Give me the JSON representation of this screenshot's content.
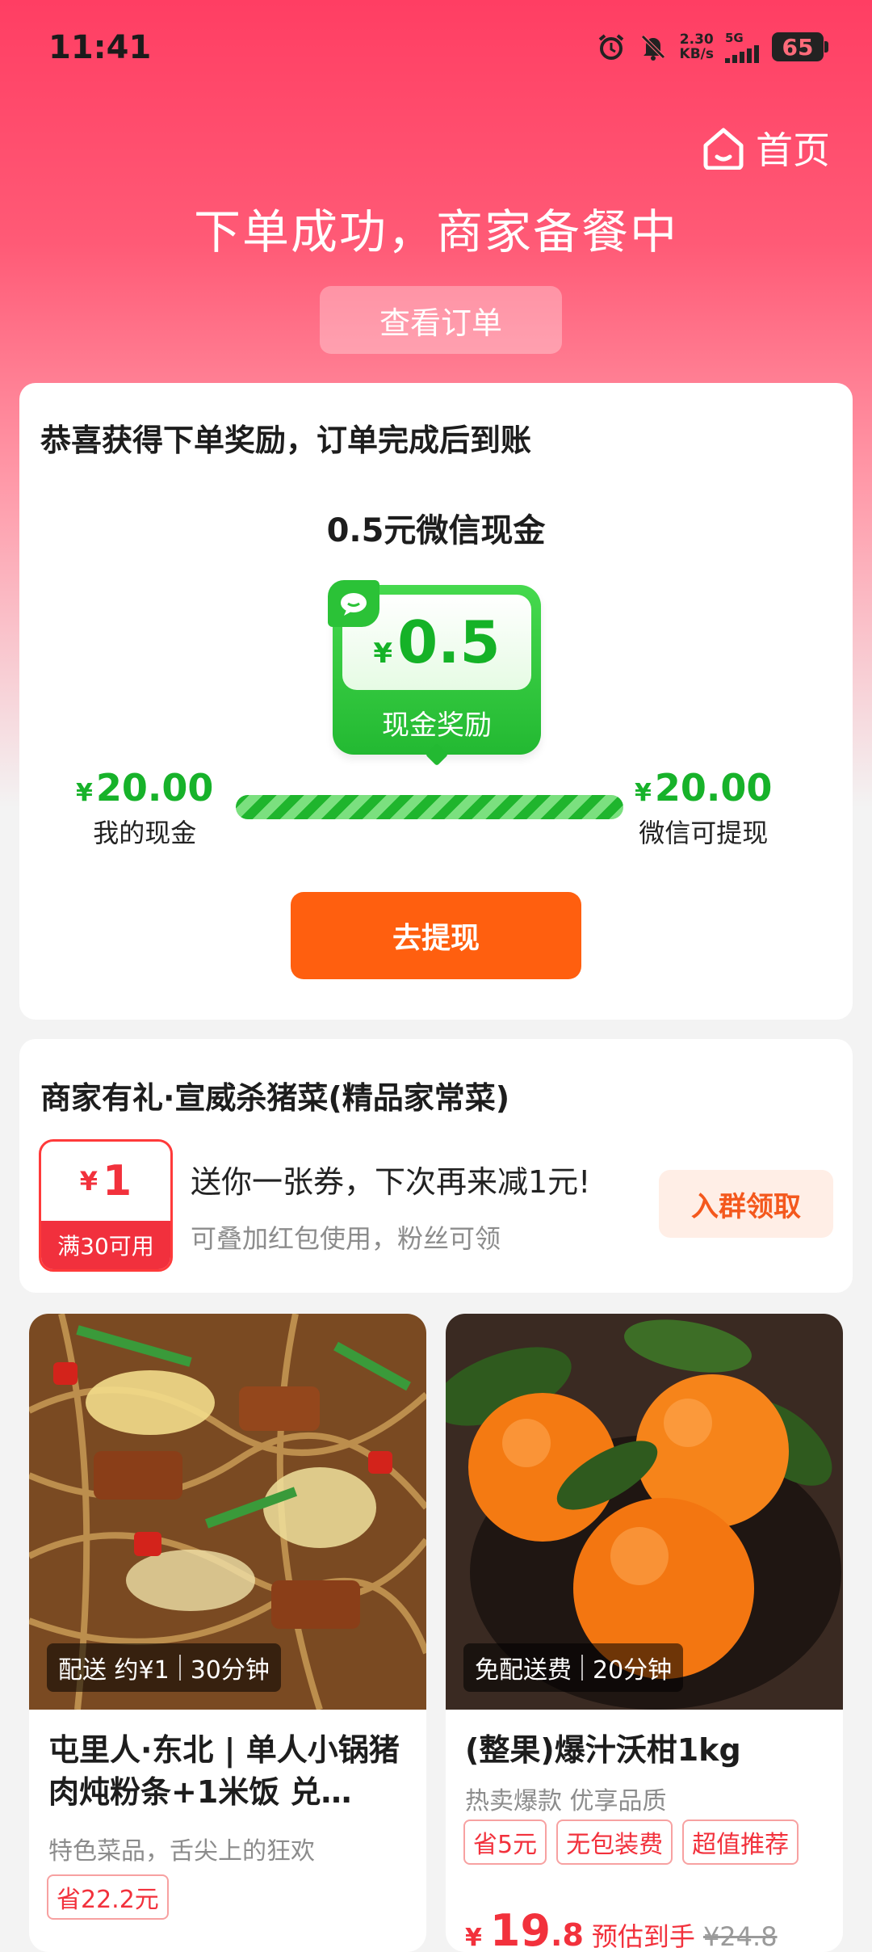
{
  "status_bar": {
    "time": "11:41",
    "net_speed_value": "2.30",
    "net_speed_unit": "KB/s",
    "network": "5G",
    "battery": "65"
  },
  "header": {
    "home_label": "首页",
    "headline": "下单成功，商家备餐中",
    "view_order_label": "查看订单"
  },
  "reward": {
    "title": "恭喜获得下单奖励，订单完成后到账",
    "amount_text": "0.5元微信现金",
    "badge_currency": "¥",
    "badge_value": "0.5",
    "badge_caption": "现金奖励",
    "my_cash_currency": "¥",
    "my_cash_value": "20.00",
    "my_cash_label": "我的现金",
    "withdrawable_currency": "¥",
    "withdrawable_value": "20.00",
    "withdrawable_label": "微信可提现",
    "progress_fraction": 1.0,
    "withdraw_button": "去提现"
  },
  "merchant": {
    "title": "商家有礼·宣威杀猪菜(精品家常菜)",
    "coupon_currency": "¥",
    "coupon_value": "1",
    "coupon_condition": "满30可用",
    "coupon_desc": "送你一张券，下次再来减1元!",
    "coupon_sub": "可叠加红包使用，粉丝可领",
    "join_button": "入群领取"
  },
  "products": [
    {
      "delivery_fee": "配送 约¥1",
      "delivery_time": "30分钟",
      "title": "屯里人·东北 | 单人小锅猪肉炖粉条+1米饭 兑…",
      "subtitle": "特色菜品，舌尖上的狂欢",
      "tags": [
        "省22.2元"
      ]
    },
    {
      "delivery_fee": "免配送费",
      "delivery_time": "20分钟",
      "title": "(整果)爆汁沃柑1kg",
      "subtitle": "热卖爆款 优享品质",
      "tags": [
        "省5元",
        "无包装费",
        "超值推荐"
      ],
      "price_currency": "¥",
      "price_int": "19",
      "price_dec": ".8",
      "price_estimate": "预估到手",
      "price_original": "¥24.8"
    }
  ],
  "colors": {
    "accent_red": "#ff3e63",
    "cash_green": "#17b22a",
    "withdraw_orange": "#ff5f0f",
    "price_red": "#f2313c"
  },
  "icons": [
    "alarm-icon",
    "mute-bell-icon",
    "signal-icon",
    "battery-icon",
    "home-icon",
    "wechat-icon"
  ]
}
